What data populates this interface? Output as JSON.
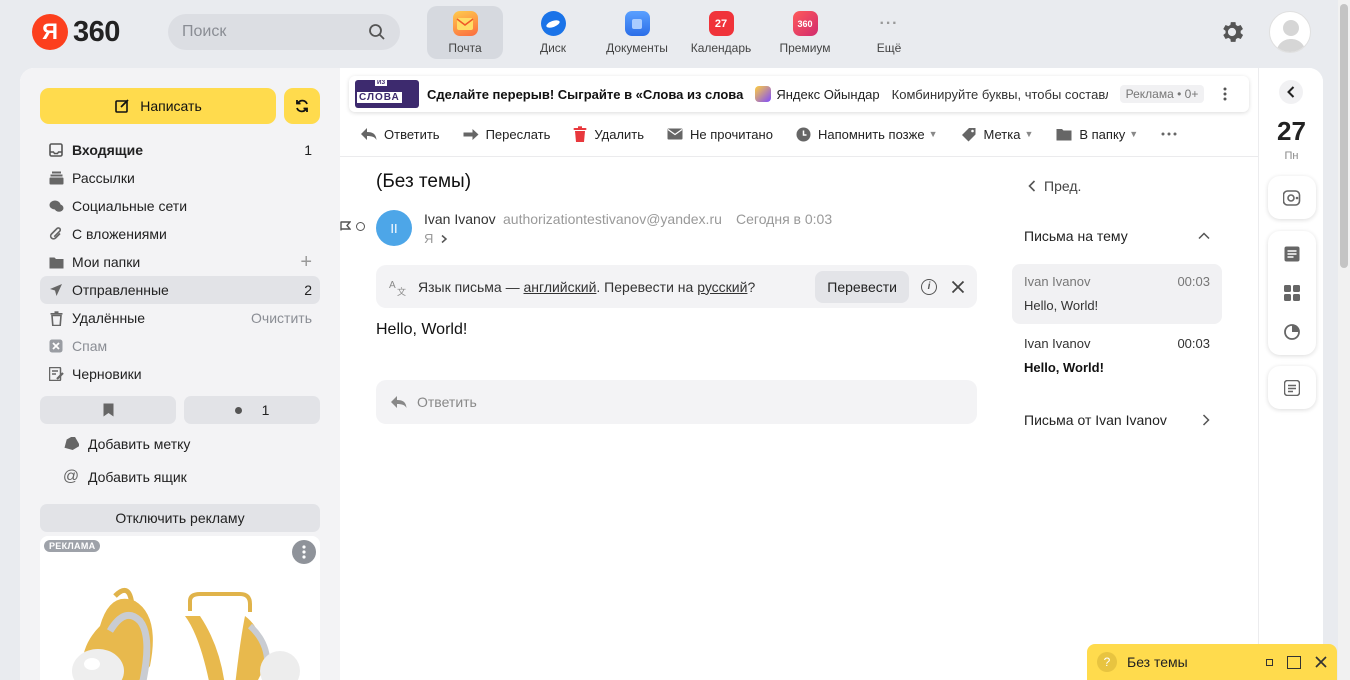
{
  "colors": {
    "accent": "#ffdb4d",
    "brand_red": "#fc3f1d",
    "avatar": "#4da6e8"
  },
  "header": {
    "logo_letter": "Я",
    "logo_text": "360",
    "search_placeholder": "Поиск",
    "apps": [
      {
        "label": "Почта",
        "icon": "mail-icon"
      },
      {
        "label": "Диск",
        "icon": "disk-icon"
      },
      {
        "label": "Документы",
        "icon": "documents-icon"
      },
      {
        "label": "Календарь",
        "icon": "calendar-icon",
        "badge": "27"
      },
      {
        "label": "Премиум",
        "icon": "premium-icon",
        "badge": "360"
      },
      {
        "label": "Ещё",
        "icon": "more-icon"
      }
    ]
  },
  "sidebar": {
    "compose_label": "Написать",
    "folders": [
      {
        "label": "Входящие",
        "count": "1",
        "icon": "inbox-icon"
      },
      {
        "label": "Рассылки",
        "count": "",
        "icon": "newsletters-icon"
      },
      {
        "label": "Социальные сети",
        "count": "",
        "icon": "social-icon"
      },
      {
        "label": "С вложениями",
        "count": "",
        "icon": "attachment-icon"
      },
      {
        "label": "Мои папки",
        "count": "+",
        "icon": "folder-icon"
      },
      {
        "label": "Отправленные",
        "count": "2",
        "icon": "sent-icon"
      },
      {
        "label": "Удалённые",
        "count": "Очистить",
        "icon": "trash-icon"
      },
      {
        "label": "Спам",
        "count": "",
        "icon": "spam-icon"
      },
      {
        "label": "Черновики",
        "count": "",
        "icon": "drafts-icon"
      }
    ],
    "filter_unread_count": "1",
    "add_label": "Добавить метку",
    "add_box": "Добавить ящик",
    "disable_ads": "Отключить рекламу",
    "ad_badge": "РЕКЛАМА"
  },
  "banner": {
    "image_text_top": "ИЗ",
    "image_text": "СЛОВА",
    "title": "Сделайте перерыв! Сыграйте в «Слова из слова",
    "source": "Яндекс Ойындар",
    "text": "Комбинируйте буквы, чтобы составлять слова",
    "tag": "Реклама • 0+"
  },
  "toolbar": {
    "reply": "Ответить",
    "forward": "Переслать",
    "delete": "Удалить",
    "unread": "Не прочитано",
    "remind": "Напомнить позже",
    "label": "Метка",
    "move": "В папку"
  },
  "message": {
    "subject": "(Без темы)",
    "sender_initials": "II",
    "sender_name": "Ivan Ivanov",
    "sender_email": "authorizationtestivanov@yandex.ru",
    "date": "Сегодня в 0:03",
    "to": "Я",
    "translate": {
      "prefix": "Язык письма — ",
      "lang": "английский",
      "mid": ". Перевести на ",
      "target": "русский",
      "suffix": "?",
      "button": "Перевести"
    },
    "body": "Hello, World!",
    "reply_placeholder": "Ответить"
  },
  "thread": {
    "prev": "Пред.",
    "title": "Письма на тему",
    "items": [
      {
        "from": "Ivan Ivanov",
        "time": "00:03",
        "text": "Hello, World!"
      },
      {
        "from": "Ivan Ivanov",
        "time": "00:03",
        "text": "Hello, World!"
      }
    ],
    "from_link": "Письма от Ivan Ivanov"
  },
  "right": {
    "day": "27",
    "weekday": "Пн"
  },
  "minibar": {
    "title": "Без темы"
  }
}
